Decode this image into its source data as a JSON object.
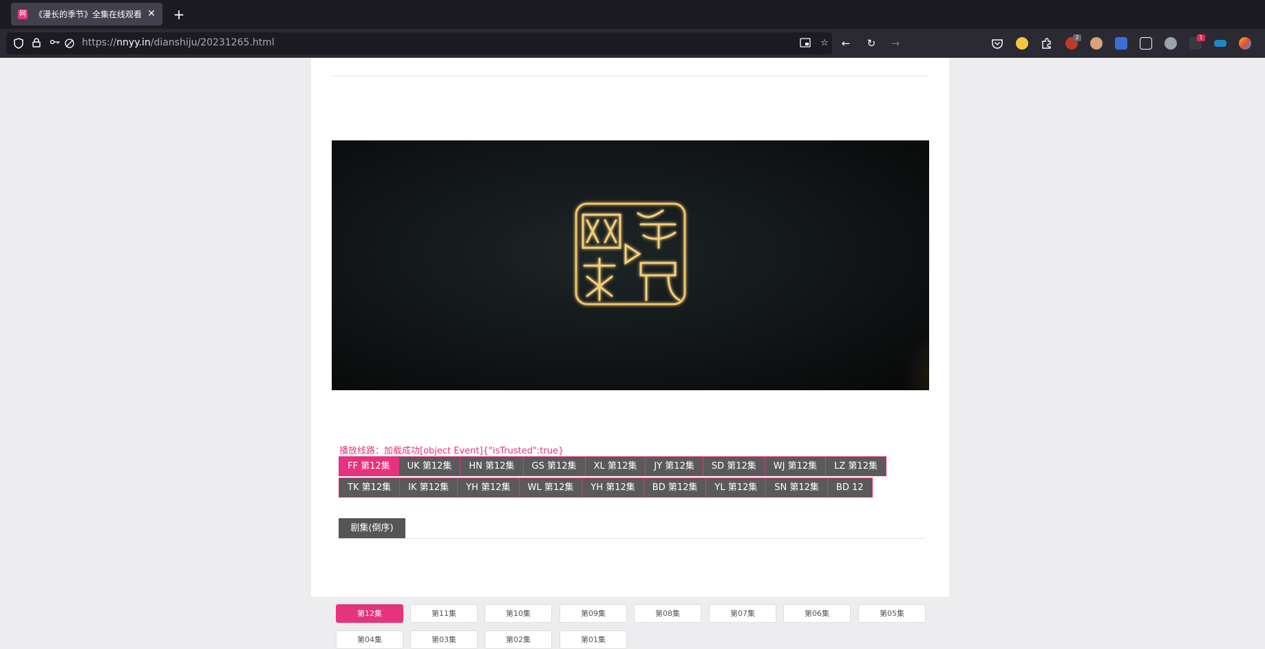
{
  "browser": {
    "tab_title": "《漫长的季节》全集在线观看",
    "tab_favicon": "网",
    "url_prefix": "https://",
    "url_domain": "nnyy.in",
    "url_path": "/dianshiju/20231265.html",
    "extension_badges": [
      "2",
      "1"
    ]
  },
  "player": {
    "logo_text": "网络视听",
    "logo_icon": "play-icon"
  },
  "status_text": "播放线路：加载成功[object Event]{\"isTrusted\":true}",
  "lines_row1": [
    "FF 第12集",
    "UK 第12集",
    "HN 第12集",
    "GS 第12集",
    "XL 第12集",
    "JY 第12集",
    "SD 第12集",
    "WJ 第12集",
    "LZ 第12集"
  ],
  "lines_row2": [
    "TK 第12集",
    "IK 第12集",
    "YH 第12集",
    "WL 第12集",
    "YH 第12集",
    "BD 第12集",
    "YL 第12集",
    "SN 第12集",
    "BD 12"
  ],
  "episodes_tab": "剧集(倒序)",
  "episodes": [
    "第12集",
    "第11集",
    "第10集",
    "第09集",
    "第08集",
    "第07集",
    "第06集",
    "第05集",
    "第04集",
    "第03集",
    "第02集",
    "第01集"
  ],
  "colors": {
    "accent": "#e5337d",
    "line_bg": "#5a5a5a",
    "chrome_bg": "#1c1b22"
  }
}
